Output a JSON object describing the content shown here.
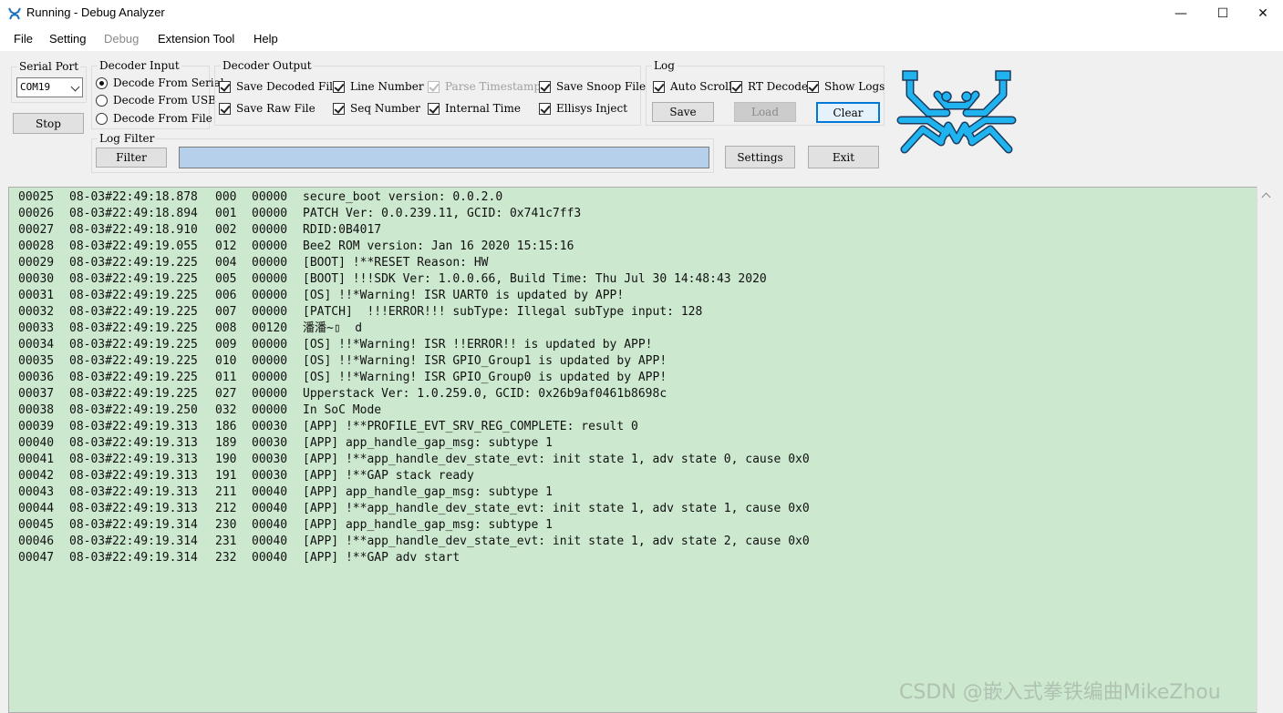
{
  "window": {
    "title": "Running - Debug Analyzer",
    "controls": {
      "minimize": "—",
      "maximize": "☐",
      "close": "✕"
    }
  },
  "menu": {
    "file": "File",
    "setting": "Setting",
    "debug": "Debug",
    "extension_tool": "Extension Tool",
    "help": "Help"
  },
  "serial_port": {
    "title": "Serial Port",
    "port": "COM19",
    "stop_button": "Stop"
  },
  "decoder_input": {
    "title": "Decoder Input",
    "options": [
      {
        "label": "Decode From Serial",
        "selected": true
      },
      {
        "label": "Decode From USB",
        "selected": false
      },
      {
        "label": "Decode From File",
        "selected": false
      }
    ]
  },
  "decoder_output": {
    "title": "Decoder Output",
    "save_decoded_file": {
      "label": "Save Decoded File",
      "checked": true
    },
    "save_raw_file": {
      "label": "Save Raw File",
      "checked": true
    },
    "line_number": {
      "label": "Line Number",
      "checked": true
    },
    "seq_number": {
      "label": "Seq Number",
      "checked": true
    },
    "parse_timestamp": {
      "label": "Parse Timestamp",
      "checked": true,
      "disabled": true
    },
    "internal_time": {
      "label": "Internal Time",
      "checked": true
    },
    "save_snoop_file": {
      "label": "Save Snoop File",
      "checked": true
    },
    "ellisys_inject": {
      "label": "Ellisys Inject",
      "checked": true
    }
  },
  "log_group": {
    "title": "Log",
    "auto_scroll": {
      "label": "Auto Scroll",
      "checked": true
    },
    "rt_decode": {
      "label": "RT Decode",
      "checked": true
    },
    "show_logs": {
      "label": "Show Logs",
      "checked": true
    },
    "save": "Save",
    "load": "Load",
    "clear": "Clear"
  },
  "log_filter": {
    "title": "Log Filter",
    "filter_button": "Filter",
    "filter_value": ""
  },
  "actions": {
    "settings": "Settings",
    "exit": "Exit"
  },
  "log_lines": [
    {
      "line": "00025",
      "time": "08-03#22:49:18.878",
      "seq": "000",
      "code": "00000",
      "msg": "secure_boot version: 0.0.2.0"
    },
    {
      "line": "00026",
      "time": "08-03#22:49:18.894",
      "seq": "001",
      "code": "00000",
      "msg": "PATCH Ver: 0.0.239.11, GCID: 0x741c7ff3"
    },
    {
      "line": "00027",
      "time": "08-03#22:49:18.910",
      "seq": "002",
      "code": "00000",
      "msg": "RDID:0B4017"
    },
    {
      "line": "00028",
      "time": "08-03#22:49:19.055",
      "seq": "012",
      "code": "00000",
      "msg": "Bee2 ROM version: Jan 16 2020 15:15:16"
    },
    {
      "line": "00029",
      "time": "08-03#22:49:19.225",
      "seq": "004",
      "code": "00000",
      "msg": "[BOOT] !**RESET Reason: HW"
    },
    {
      "line": "00030",
      "time": "08-03#22:49:19.225",
      "seq": "005",
      "code": "00000",
      "msg": "[BOOT] !!!SDK Ver: 1.0.0.66, Build Time: Thu Jul 30 14:48:43 2020"
    },
    {
      "line": "00031",
      "time": "08-03#22:49:19.225",
      "seq": "006",
      "code": "00000",
      "msg": "[OS] !!*Warning! ISR UART0 is updated by APP!"
    },
    {
      "line": "00032",
      "time": "08-03#22:49:19.225",
      "seq": "007",
      "code": "00000",
      "msg": "[PATCH]  !!!ERROR!!! subType: Illegal subType input: 128"
    },
    {
      "line": "00033",
      "time": "08-03#22:49:19.225",
      "seq": "008",
      "code": "00120",
      "msg": "潘潘~▯  d"
    },
    {
      "line": "00034",
      "time": "08-03#22:49:19.225",
      "seq": "009",
      "code": "00000",
      "msg": "[OS] !!*Warning! ISR !!ERROR!! is updated by APP!"
    },
    {
      "line": "00035",
      "time": "08-03#22:49:19.225",
      "seq": "010",
      "code": "00000",
      "msg": "[OS] !!*Warning! ISR GPIO_Group1 is updated by APP!"
    },
    {
      "line": "00036",
      "time": "08-03#22:49:19.225",
      "seq": "011",
      "code": "00000",
      "msg": "[OS] !!*Warning! ISR GPIO_Group0 is updated by APP!"
    },
    {
      "line": "00037",
      "time": "08-03#22:49:19.225",
      "seq": "027",
      "code": "00000",
      "msg": "Upperstack Ver: 1.0.259.0, GCID: 0x26b9af0461b8698c"
    },
    {
      "line": "00038",
      "time": "08-03#22:49:19.250",
      "seq": "032",
      "code": "00000",
      "msg": "In SoC Mode"
    },
    {
      "line": "00039",
      "time": "08-03#22:49:19.313",
      "seq": "186",
      "code": "00030",
      "msg": "[APP] !**PROFILE_EVT_SRV_REG_COMPLETE: result 0"
    },
    {
      "line": "00040",
      "time": "08-03#22:49:19.313",
      "seq": "189",
      "code": "00030",
      "msg": "[APP] app_handle_gap_msg: subtype 1"
    },
    {
      "line": "00041",
      "time": "08-03#22:49:19.313",
      "seq": "190",
      "code": "00030",
      "msg": "[APP] !**app_handle_dev_state_evt: init state 1, adv state 0, cause 0x0"
    },
    {
      "line": "00042",
      "time": "08-03#22:49:19.313",
      "seq": "191",
      "code": "00030",
      "msg": "[APP] !**GAP stack ready"
    },
    {
      "line": "00043",
      "time": "08-03#22:49:19.313",
      "seq": "211",
      "code": "00040",
      "msg": "[APP] app_handle_gap_msg: subtype 1"
    },
    {
      "line": "00044",
      "time": "08-03#22:49:19.313",
      "seq": "212",
      "code": "00040",
      "msg": "[APP] !**app_handle_dev_state_evt: init state 1, adv state 1, cause 0x0"
    },
    {
      "line": "00045",
      "time": "08-03#22:49:19.314",
      "seq": "230",
      "code": "00040",
      "msg": "[APP] app_handle_gap_msg: subtype 1"
    },
    {
      "line": "00046",
      "time": "08-03#22:49:19.314",
      "seq": "231",
      "code": "00040",
      "msg": "[APP] !**app_handle_dev_state_evt: init state 1, adv state 2, cause 0x0"
    },
    {
      "line": "00047",
      "time": "08-03#22:49:19.314",
      "seq": "232",
      "code": "00040",
      "msg": "[APP] !**GAP adv start"
    }
  ],
  "watermark": "CSDN @嵌入式拳铁编曲MikeZhou",
  "colors": {
    "log_background": "#cce8cf",
    "logo_blue": "#1fb3f0",
    "filter_input": "#b6cfea",
    "default_button_border": "#0078d7"
  },
  "icons": {
    "app": "realtek-crab-icon",
    "logo": "realtek-crab-logo"
  }
}
